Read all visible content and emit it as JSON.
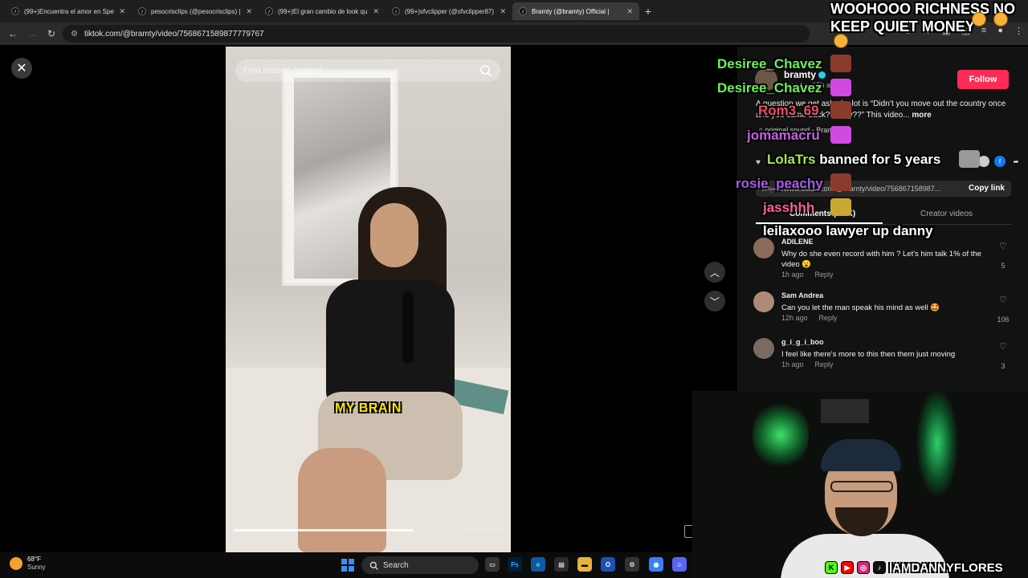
{
  "browser": {
    "tabs": [
      {
        "label": "(99+)Encuentra el amor en Spe",
        "active": false
      },
      {
        "label": "pesocrisclips (@pesocrisclips) |",
        "active": false
      },
      {
        "label": "(99+)El gran cambio de look qu",
        "active": false
      },
      {
        "label": "(99+)sfvclipper (@sfvclipper87)",
        "active": false
      },
      {
        "label": "Bramty (@bramty) Official |",
        "active": true
      }
    ],
    "url": "tiktok.com/@bramty/video/7568671589877779767"
  },
  "video": {
    "search_placeholder": "Find related content",
    "caption": "MY BRAIN",
    "time": "01:34/01:47",
    "progress_fraction": 0.67
  },
  "panel": {
    "author": "bramty",
    "author_sub": "bramty · 15h ago",
    "follow_label": "Follow",
    "description": "A question we get asked a lot is “Didn’t you move out the country once and you came back?? Why??” This video...",
    "more_label": "more",
    "sound": "original sound - Bramty",
    "link": "https://www.tiktok.com/@bramty/video/756867158987...",
    "copy_link_label": "Copy link",
    "tabs": {
      "comments": "Comments (1.2K)",
      "creator": "Creator videos"
    },
    "comments": [
      {
        "name": "ADILENE",
        "text": "Why do she even record with him ? Let's him talk 1% of the video 😮",
        "time": "1h ago",
        "reply": "Reply",
        "likes": "5"
      },
      {
        "name": "Sam Andrea",
        "text": "Can you let the man speak his mind as well 🤩",
        "time": "12h ago",
        "reply": "Reply",
        "likes": "106"
      },
      {
        "name": "g_i_g_i_boo",
        "text": "I feel like there's more to this then them just moving",
        "time": "1h ago",
        "reply": "Reply",
        "likes": "3"
      }
    ]
  },
  "overlay": {
    "top_text": "WOOHOOO RICHNESS NO KEEP QUIET MONEY",
    "chat": [
      {
        "user": "Desiree_Chavez",
        "color": "#6cf05a"
      },
      {
        "user": "Desiree_Chavez",
        "color": "#6cf05a"
      },
      {
        "user": "Rom3_69",
        "color": "#e94b6a"
      },
      {
        "user": "jomamacru",
        "color": "#c560e8"
      },
      {
        "user": "LolaTrs",
        "color": "#a6e84a",
        "message": "banned for 5 years"
      },
      {
        "user": "rosie_peachy",
        "color": "#a65be8"
      },
      {
        "user": "jasshhh",
        "color": "#ff5fa2"
      },
      {
        "user": "leilaxooo",
        "color": "#ffffff",
        "message": "lawyer up danny"
      }
    ]
  },
  "webcam": {
    "handle": "IAMDANNYFLORES"
  },
  "taskbar": {
    "temp": "68°F",
    "condition": "Sunny",
    "search_label": "Search"
  }
}
